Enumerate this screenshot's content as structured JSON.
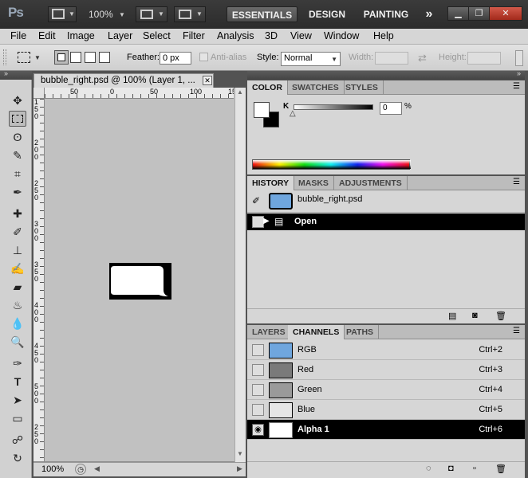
{
  "app": {
    "logo": "Ps",
    "zoom": "100%",
    "workspaces": [
      "ESSENTIALS",
      "DESIGN",
      "PAINTING"
    ],
    "more": "»"
  },
  "menu": [
    "File",
    "Edit",
    "Image",
    "Layer",
    "Select",
    "Filter",
    "Analysis",
    "3D",
    "View",
    "Window",
    "Help"
  ],
  "options": {
    "feather_label": "Feather:",
    "feather_value": "0 px",
    "antialias_label": "Anti-alias",
    "style_label": "Style:",
    "style_value": "Normal",
    "width_label": "Width:",
    "height_label": "Height:"
  },
  "document": {
    "tab_title": "bubble_right.psd @ 100% (Layer 1, ...",
    "zoom": "100%",
    "ruler_h": [
      "50",
      "0",
      "50",
      "100",
      "15"
    ],
    "ruler_v": [
      "1",
      "5",
      "0",
      "2",
      "0",
      "0",
      "2",
      "5",
      "0",
      "3",
      "0",
      "0",
      "3",
      "5",
      "0",
      "4",
      "0",
      "0",
      "4",
      "5",
      "0",
      "5",
      "0",
      "0",
      "2",
      "5",
      "0"
    ]
  },
  "color_panel": {
    "tabs": [
      "COLOR",
      "SWATCHES",
      "STYLES"
    ],
    "channel_label": "K",
    "value": "0",
    "unit": "%",
    "foreground": "#ffffff",
    "background": "#000000"
  },
  "history_panel": {
    "tabs": [
      "HISTORY",
      "MASKS",
      "ADJUSTMENTS"
    ],
    "snapshot": "bubble_right.psd",
    "items": [
      "Open"
    ]
  },
  "channels_panel": {
    "tabs": [
      "LAYERS",
      "CHANNELS",
      "PATHS"
    ],
    "channels": [
      {
        "name": "RGB",
        "shortcut": "Ctrl+2",
        "visible": false,
        "selected": false
      },
      {
        "name": "Red",
        "shortcut": "Ctrl+3",
        "visible": false,
        "selected": false
      },
      {
        "name": "Green",
        "shortcut": "Ctrl+4",
        "visible": false,
        "selected": false
      },
      {
        "name": "Blue",
        "shortcut": "Ctrl+5",
        "visible": false,
        "selected": false
      },
      {
        "name": "Alpha 1",
        "shortcut": "Ctrl+6",
        "visible": true,
        "selected": true
      }
    ]
  },
  "colors": {
    "selected_row": "#000000",
    "thumb_rgb": "#6fa6de"
  }
}
